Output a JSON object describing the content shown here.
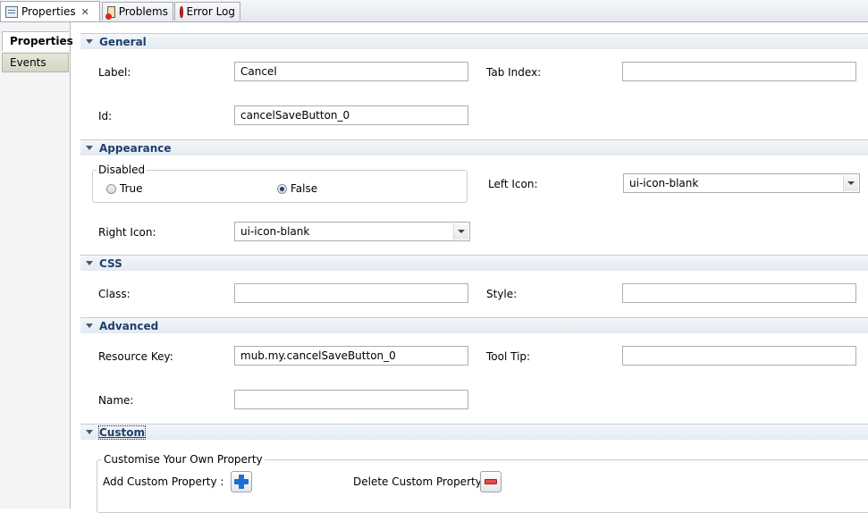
{
  "tabs": [
    {
      "label": "Properties",
      "active": true,
      "icon": "properties-icon"
    },
    {
      "label": "Problems",
      "active": false,
      "icon": "problems-icon"
    },
    {
      "label": "Error Log",
      "active": false,
      "icon": "error-log-icon"
    }
  ],
  "side_tabs": [
    {
      "label": "Properties",
      "active": true
    },
    {
      "label": "Events",
      "active": false
    }
  ],
  "general": {
    "title": "General",
    "label_label": "Label:",
    "label_value": "Cancel",
    "tab_index_label": "Tab Index:",
    "tab_index_value": "",
    "id_label": "Id:",
    "id_value": "cancelSaveButton_0"
  },
  "appearance": {
    "title": "Appearance",
    "disabled_label": "Disabled",
    "true_label": "True",
    "false_label": "False",
    "selected": "False",
    "left_icon_label": "Left Icon:",
    "left_icon_value": "ui-icon-blank",
    "right_icon_label": "Right Icon:",
    "right_icon_value": "ui-icon-blank"
  },
  "css": {
    "title": "CSS",
    "class_label": "Class:",
    "class_value": "",
    "style_label": "Style:",
    "style_value": ""
  },
  "advanced": {
    "title": "Advanced",
    "resource_key_label": "Resource Key:",
    "resource_key_value": "mub.my.cancelSaveButton_0",
    "tool_tip_label": "Tool Tip:",
    "tool_tip_value": "",
    "name_label": "Name:",
    "name_value": ""
  },
  "custom": {
    "title": "Custom",
    "group_label": "Customise Your Own Property",
    "add_label": "Add Custom Property :",
    "delete_label": "Delete Custom Property :"
  },
  "colors": {
    "section_title": "#203f6a",
    "add_icon": "#1d6fd1",
    "delete_icon": "#e24b4b"
  }
}
